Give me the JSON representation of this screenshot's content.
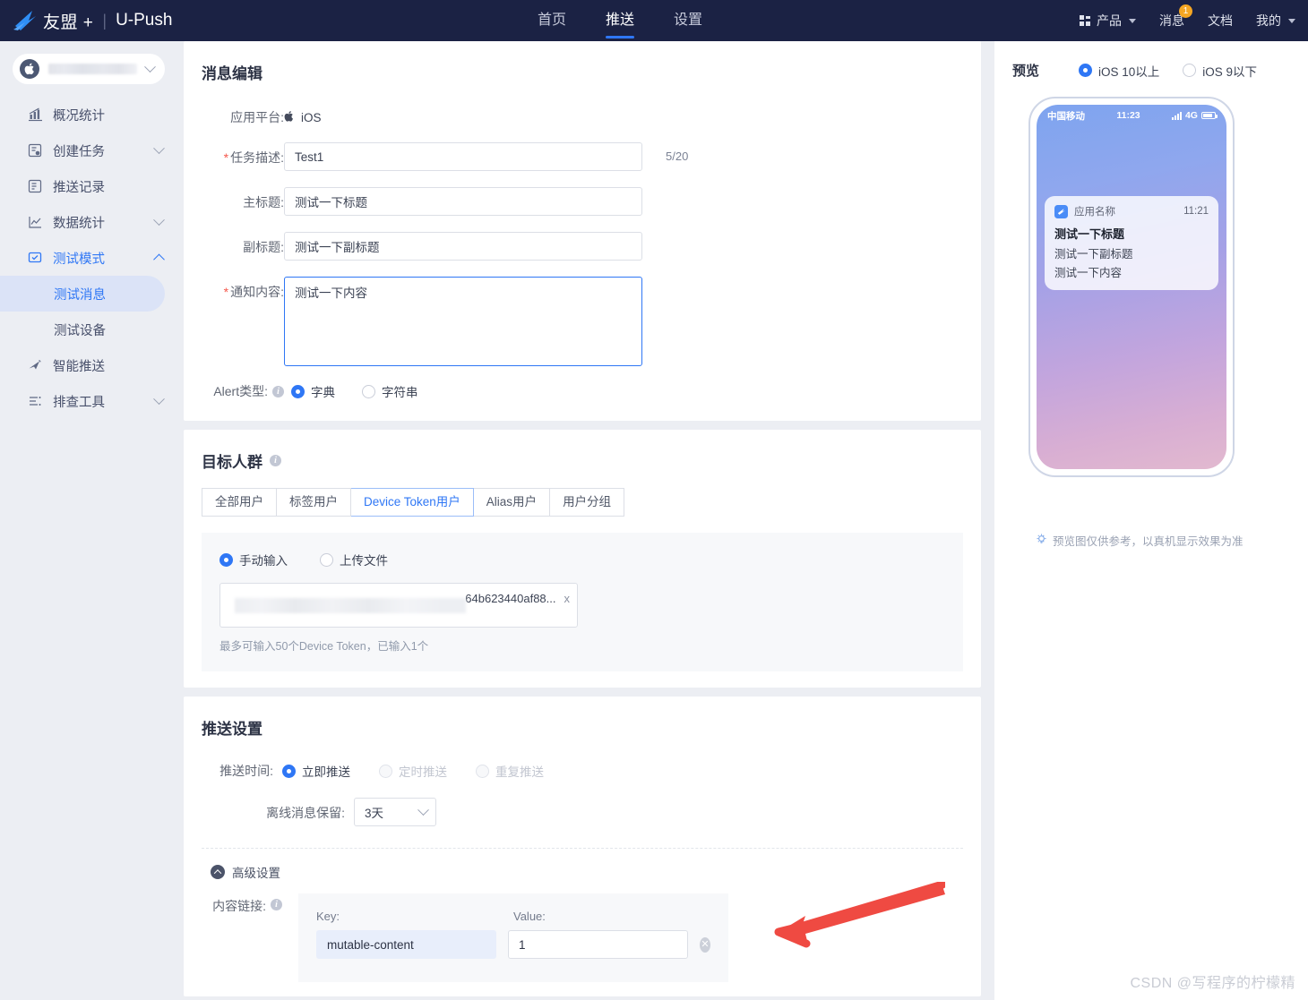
{
  "topnav": {
    "brand": "友盟 +",
    "brand_sep": "|",
    "brand_sub": "U-Push",
    "center_items": [
      {
        "label": "首页",
        "active": false
      },
      {
        "label": "推送",
        "active": true
      },
      {
        "label": "设置",
        "active": false
      }
    ],
    "right_items": [
      {
        "label": "产品",
        "caret": true,
        "icon": "grid-icon"
      },
      {
        "label": "消息",
        "badge": "1"
      },
      {
        "label": "文档"
      },
      {
        "label": "我的",
        "caret": true
      }
    ],
    "bg_color": "#1b2244",
    "accent_color": "#2f77f5",
    "badge_color": "#f5a623"
  },
  "sidebar": {
    "app_selector": {
      "name_redacted": true,
      "icon": "apple-icon"
    },
    "items": [
      {
        "label": "概况统计",
        "icon": "bar-chart-icon",
        "expandable": false,
        "active": false
      },
      {
        "label": "创建任务",
        "icon": "create-task-icon",
        "expandable": true,
        "expanded": false,
        "active": false
      },
      {
        "label": "推送记录",
        "icon": "push-record-icon",
        "expandable": false,
        "active": false
      },
      {
        "label": "数据统计",
        "icon": "line-chart-icon",
        "expandable": true,
        "expanded": false,
        "active": false
      },
      {
        "label": "测试模式",
        "icon": "test-mode-icon",
        "expandable": true,
        "expanded": true,
        "active": true
      },
      {
        "label": "智能推送",
        "icon": "smart-push-icon",
        "expandable": false,
        "active": false
      },
      {
        "label": "排查工具",
        "icon": "troubleshoot-icon",
        "expandable": true,
        "expanded": false,
        "active": false
      }
    ],
    "submenu": [
      {
        "label": "测试消息",
        "selected": true
      },
      {
        "label": "测试设备",
        "selected": false
      }
    ]
  },
  "message_edit": {
    "title": "消息编辑",
    "platform_label": "应用平台:",
    "platform_value": "iOS",
    "task_desc_label": "任务描述:",
    "task_desc_value": "Test1",
    "task_desc_counter": "5/20",
    "main_title_label": "主标题:",
    "main_title_value": "测试一下标题",
    "sub_title_label": "副标题:",
    "sub_title_value": "测试一下副标题",
    "content_label": "通知内容:",
    "content_value": "测试一下内容",
    "alert_type_label": "Alert类型:",
    "alert_options": [
      {
        "label": "字典",
        "selected": true
      },
      {
        "label": "字符串",
        "selected": false
      }
    ]
  },
  "target_audience": {
    "title": "目标人群",
    "tabs": [
      {
        "label": "全部用户",
        "active": false
      },
      {
        "label": "标签用户",
        "active": false
      },
      {
        "label": "Device Token用户",
        "active": true
      },
      {
        "label": "Alias用户",
        "active": false
      },
      {
        "label": "用户分组",
        "active": false
      }
    ],
    "input_modes": [
      {
        "label": "手动输入",
        "selected": true
      },
      {
        "label": "上传文件",
        "selected": false
      }
    ],
    "token_chip": "64b623440af88...",
    "token_remove": "x",
    "token_hint": "最多可输入50个Device Token，已输入1个"
  },
  "push_settings": {
    "title": "推送设置",
    "push_time_label": "推送时间:",
    "push_time_options": [
      {
        "label": "立即推送",
        "selected": true,
        "disabled": false
      },
      {
        "label": "定时推送",
        "selected": false,
        "disabled": true
      },
      {
        "label": "重复推送",
        "selected": false,
        "disabled": true
      }
    ],
    "offline_label": "离线消息保留:",
    "offline_value": "3天",
    "advanced_label": "高级设置",
    "content_link_label": "内容链接:",
    "kv_key_header": "Key:",
    "kv_value_header": "Value:",
    "kv_rows": [
      {
        "key": "mutable-content",
        "value": "1"
      }
    ]
  },
  "preview": {
    "title": "预览",
    "options": [
      {
        "label": "iOS 10以上",
        "selected": true
      },
      {
        "label": "iOS 9以下",
        "selected": false
      }
    ],
    "phone": {
      "carrier": "中国移动",
      "time": "11:23",
      "network": "4G",
      "notification": {
        "app_name": "应用名称",
        "time": "11:21",
        "title": "测试一下标题",
        "subtitle": "测试一下副标题",
        "body": "测试一下内容"
      }
    },
    "footnote": "预览图仅供参考，以真机显示效果为准"
  },
  "annotation": {
    "arrow_color": "#ef4a42"
  },
  "watermark": "CSDN @写程序的柠檬精"
}
